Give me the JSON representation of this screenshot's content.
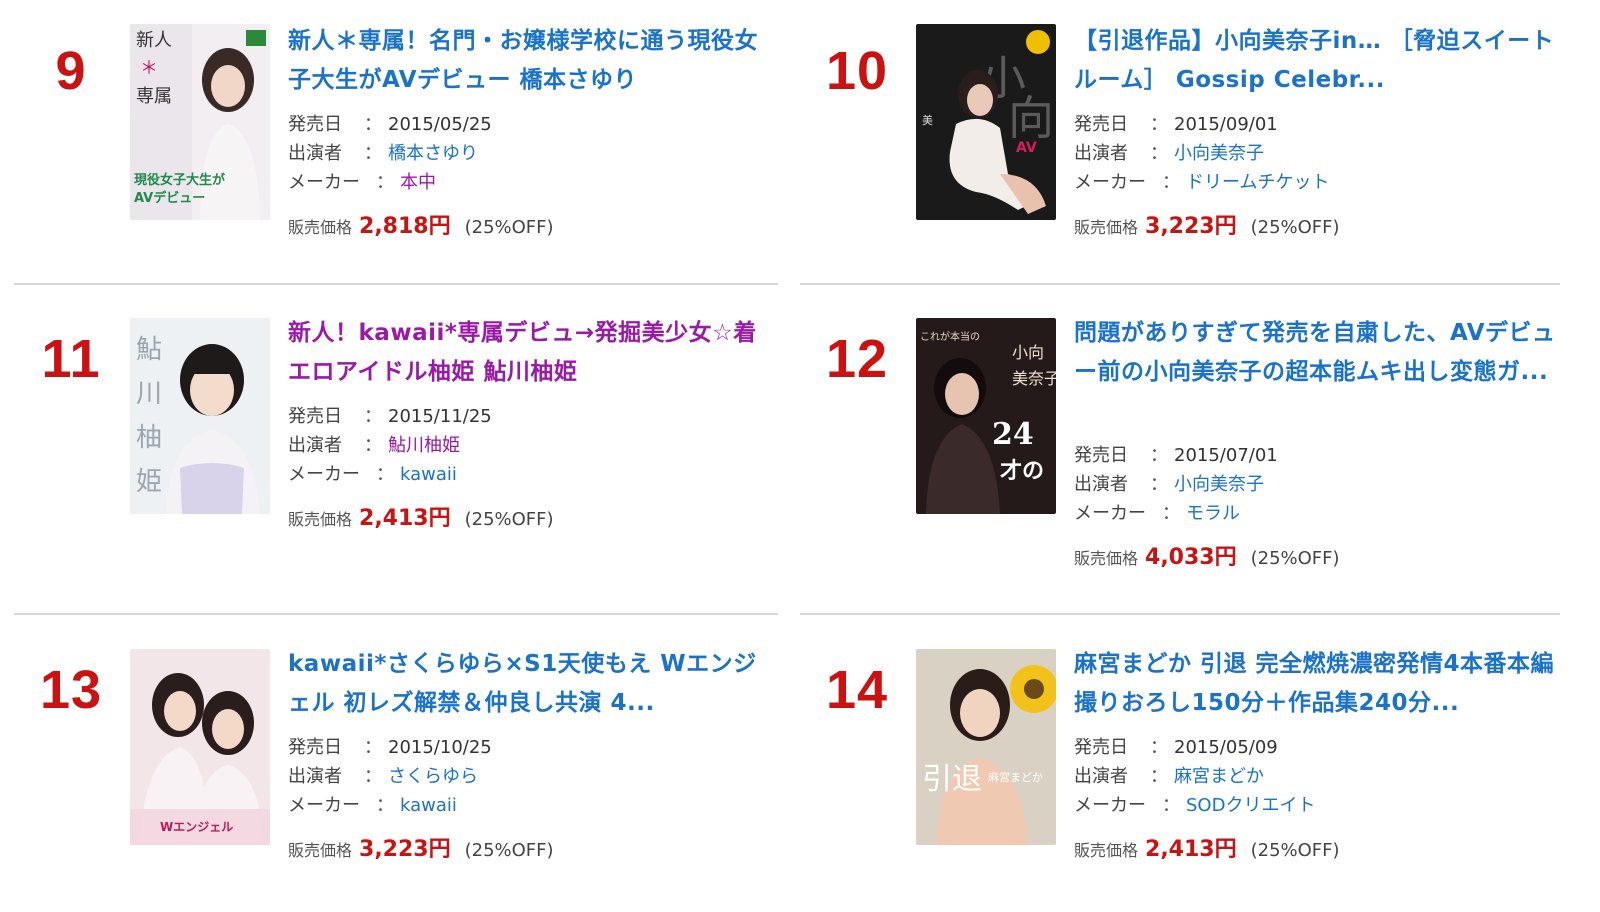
{
  "colors": {
    "rank": "#cc1111",
    "title_blue": "#1a73c9",
    "title_visited": "#9a1aa8",
    "price": "#cc1111"
  },
  "labels": {
    "release": "発売日",
    "cast": "出演者",
    "maker": "メーカー",
    "colon": "：",
    "price": "販売価格"
  },
  "items": [
    {
      "rank": "9",
      "title": "新人＊専属！名門・お嬢様学校に通う現役女子大生がAVデビュー 橋本さゆり",
      "date": "2015/05/25",
      "cast": "橋本さゆり",
      "maker": "本中",
      "price": "2,818円",
      "discount": "(25%OFF)",
      "title_color": "#1a73c9",
      "cast_color": "#1a73c9",
      "maker_color": "#9a1aa8",
      "thumb": {
        "icon": "cover-image",
        "caption": "新人＊専属！現役女子大生がAVデビュー",
        "bg": "#e9e4ea"
      }
    },
    {
      "rank": "10",
      "title": "【引退作品】小向美奈子in… ［脅迫スイートルーム］ Gossip Celebr...",
      "date": "2015/09/01",
      "cast": "小向美奈子",
      "maker": "ドリームチケット",
      "price": "3,223円",
      "discount": "(25%OFF)",
      "title_color": "#1a73c9",
      "cast_color": "#1a73c9",
      "maker_color": "#1a73c9",
      "thumb": {
        "icon": "cover-image",
        "caption": "小向",
        "bg": "#1b1b1b"
      }
    },
    {
      "rank": "11",
      "title": "新人！kawaii*専属デビュ→発掘美少女☆着エロアイドル柚姫 鮎川柚姫",
      "date": "2015/11/25",
      "cast": "鮎川柚姫",
      "maker": "kawaii",
      "price": "2,413円",
      "discount": "(25%OFF)",
      "title_color": "#9a1aa8",
      "cast_color": "#9a1aa8",
      "maker_color": "#1a73c9",
      "thumb": {
        "icon": "cover-image",
        "caption": "鮎川柚姫",
        "bg": "#eef1f3"
      }
    },
    {
      "rank": "12",
      "title": "問題がありすぎて発売を自粛した、AVデビュー前の小向美奈子の超本能ムキ出し変態ガ...",
      "date": "2015/07/01",
      "cast": "小向美奈子",
      "maker": "モラル",
      "price": "4,033円",
      "discount": "(25%OFF)",
      "title_color": "#1a73c9",
      "cast_color": "#1a73c9",
      "maker_color": "#1a73c9",
      "thumb": {
        "icon": "cover-image",
        "caption": "24才の",
        "bg": "#241b1b"
      }
    },
    {
      "rank": "13",
      "title": "kawaii*さくらゆら×S1天使もえ Wエンジェル 初レズ解禁＆仲良し共演 4...",
      "date": "2015/10/25",
      "cast": "さくらゆら",
      "maker": "kawaii",
      "price": "3,223円",
      "discount": "(25%OFF)",
      "title_color": "#1a73c9",
      "cast_color": "#1a73c9",
      "maker_color": "#1a73c9",
      "thumb": {
        "icon": "cover-image",
        "caption": "Wエンジェル",
        "bg": "#f2e4e6"
      }
    },
    {
      "rank": "14",
      "title": "麻宮まどか 引退 完全燃焼濃密発情4本番本編撮りおろし150分＋作品集240分...",
      "date": "2015/05/09",
      "cast": "麻宮まどか",
      "maker": "SODクリエイト",
      "price": "2,413円",
      "discount": "(25%OFF)",
      "title_color": "#1a73c9",
      "cast_color": "#1a73c9",
      "maker_color": "#1a73c9",
      "thumb": {
        "icon": "cover-image",
        "caption": "引退",
        "bg": "#d9d2c4"
      }
    }
  ]
}
